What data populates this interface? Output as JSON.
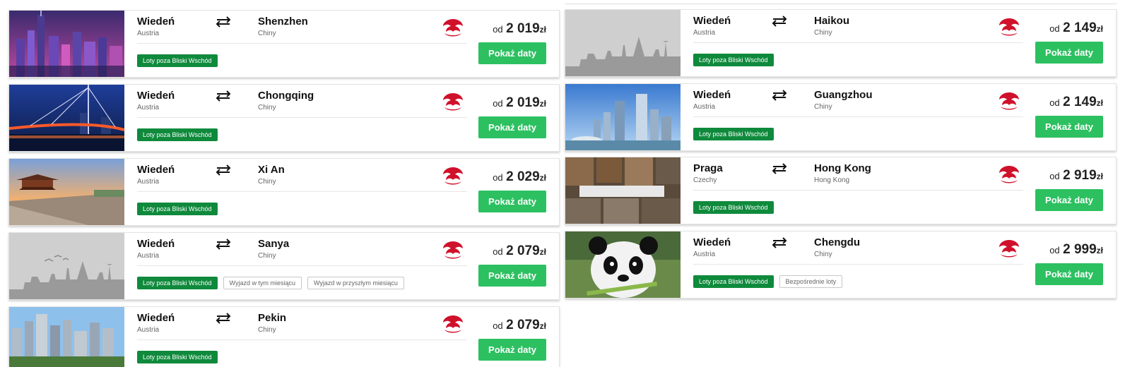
{
  "currency_prefix": "od",
  "cards_left": [
    {
      "from": "Wiedeń",
      "from_country": "Austria",
      "to": "Shenzhen",
      "to_country": "Chiny",
      "price": "2 019",
      "currency": "zł",
      "button": "Pokaż daty",
      "tags": [
        "Loty poza Bliski Wschód"
      ],
      "tags_outline": []
    },
    {
      "from": "Wiedeń",
      "from_country": "Austria",
      "to": "Chongqing",
      "to_country": "Chiny",
      "price": "2 019",
      "currency": "zł",
      "button": "Pokaż daty",
      "tags": [
        "Loty poza Bliski Wschód"
      ],
      "tags_outline": []
    },
    {
      "from": "Wiedeń",
      "from_country": "Austria",
      "to": "Xi An",
      "to_country": "Chiny",
      "price": "2 029",
      "currency": "zł",
      "button": "Pokaż daty",
      "tags": [
        "Loty poza Bliski Wschód"
      ],
      "tags_outline": []
    },
    {
      "from": "Wiedeń",
      "from_country": "Austria",
      "to": "Sanya",
      "to_country": "Chiny",
      "price": "2 079",
      "currency": "zł",
      "button": "Pokaż daty",
      "tags": [
        "Loty poza Bliski Wschód"
      ],
      "tags_outline": [
        "Wyjazd w tym miesiącu",
        "Wyjazd w przyszłym miesiącu"
      ]
    },
    {
      "from": "Wiedeń",
      "from_country": "Austria",
      "to": "Pekin",
      "to_country": "Chiny",
      "price": "2 079",
      "currency": "zł",
      "button": "Pokaż daty",
      "tags": [
        "Loty poza Bliski Wschód"
      ],
      "tags_outline": []
    }
  ],
  "cards_right": [
    {
      "from": "Wiedeń",
      "from_country": "Austria",
      "to": "Haikou",
      "to_country": "Chiny",
      "price": "2 149",
      "currency": "zł",
      "button": "Pokaż daty",
      "tags": [
        "Loty poza Bliski Wschód"
      ],
      "tags_outline": []
    },
    {
      "from": "Wiedeń",
      "from_country": "Austria",
      "to": "Guangzhou",
      "to_country": "Chiny",
      "price": "2 149",
      "currency": "zł",
      "button": "Pokaż daty",
      "tags": [
        "Loty poza Bliski Wschód"
      ],
      "tags_outline": []
    },
    {
      "from": "Praga",
      "from_country": "Czechy",
      "to": "Hong Kong",
      "to_country": "Hong Kong",
      "price": "2 919",
      "currency": "zł",
      "button": "Pokaż daty",
      "tags": [
        "Loty poza Bliski Wschód"
      ],
      "tags_outline": []
    },
    {
      "from": "Wiedeń",
      "from_country": "Austria",
      "to": "Chengdu",
      "to_country": "Chiny",
      "price": "2 999",
      "currency": "zł",
      "button": "Pokaż daty",
      "tags": [
        "Loty poza Bliski Wschód"
      ],
      "tags_outline": [
        "Bezpośrednie loty"
      ]
    }
  ],
  "airline_logo_icon": "hainan-airlines-logo-icon",
  "colors": {
    "button": "#2cc060",
    "tag": "#0f8a3c",
    "logo": "#d0112b"
  }
}
